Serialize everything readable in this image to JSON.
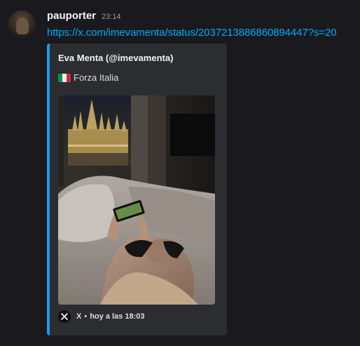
{
  "message": {
    "username": "pauporter",
    "timestamp": "23:14",
    "link": "https://x.com/imevamenta/status/2037213886860894447?s=20"
  },
  "embed": {
    "accent_color": "#1d9bf0",
    "author": "Eva Menta (@imevamenta)",
    "description_flag": "italy-flag-emoji",
    "description": "Forza Italia",
    "image": "photo-woman-on-bed-with-phone-cathedral-view",
    "footer": {
      "icon": "x-logo-icon",
      "provider": "X",
      "separator": "•",
      "time": "hoy a las 18:03"
    }
  },
  "colors": {
    "background": "#1a1a1e",
    "embed_background": "#2b2d31",
    "link": "#00a8fc",
    "username": "#f2f3f5",
    "timestamp": "#949ba4"
  }
}
